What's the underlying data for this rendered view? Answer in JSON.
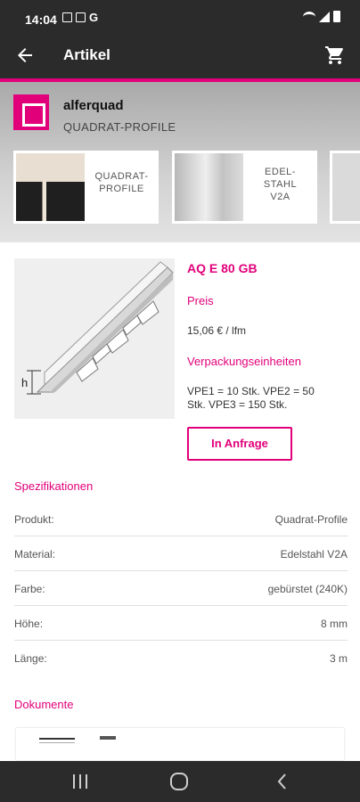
{
  "status_bar": {
    "time": "14:04"
  },
  "app_bar": {
    "title": "Artikel"
  },
  "header": {
    "brand": "alferquad",
    "category": "QUADRAT-PROFILE",
    "cards": [
      {
        "label_lines": [
          "QUADRAT-",
          "PROFILE"
        ]
      },
      {
        "label_lines": [
          "EDEL-",
          "STAHL",
          "V2A"
        ]
      }
    ]
  },
  "product": {
    "code": "AQ E 80 GB",
    "price_label": "Preis",
    "price": "15,06 € / lfm",
    "packaging_label": "Verpackungseinheiten",
    "packaging_line1": "VPE1 = 10 Stk.    VPE2 = 50",
    "packaging_line2": "Stk.    VPE3 = 150 Stk.",
    "request_button": "In Anfrage",
    "image_marker": "h"
  },
  "specs": {
    "title": "Spezifikationen",
    "rows": [
      {
        "key": "Produkt:",
        "value": "Quadrat-Profile"
      },
      {
        "key": "Material:",
        "value": "Edelstahl V2A"
      },
      {
        "key": "Farbe:",
        "value": "gebürstet (240K)"
      },
      {
        "key": "Höhe:",
        "value": "8 mm"
      },
      {
        "key": "Länge:",
        "value": "3 m"
      }
    ]
  },
  "documents": {
    "title": "Dokumente"
  },
  "colors": {
    "accent": "#e2007a",
    "bar": "#2b2b2b"
  }
}
